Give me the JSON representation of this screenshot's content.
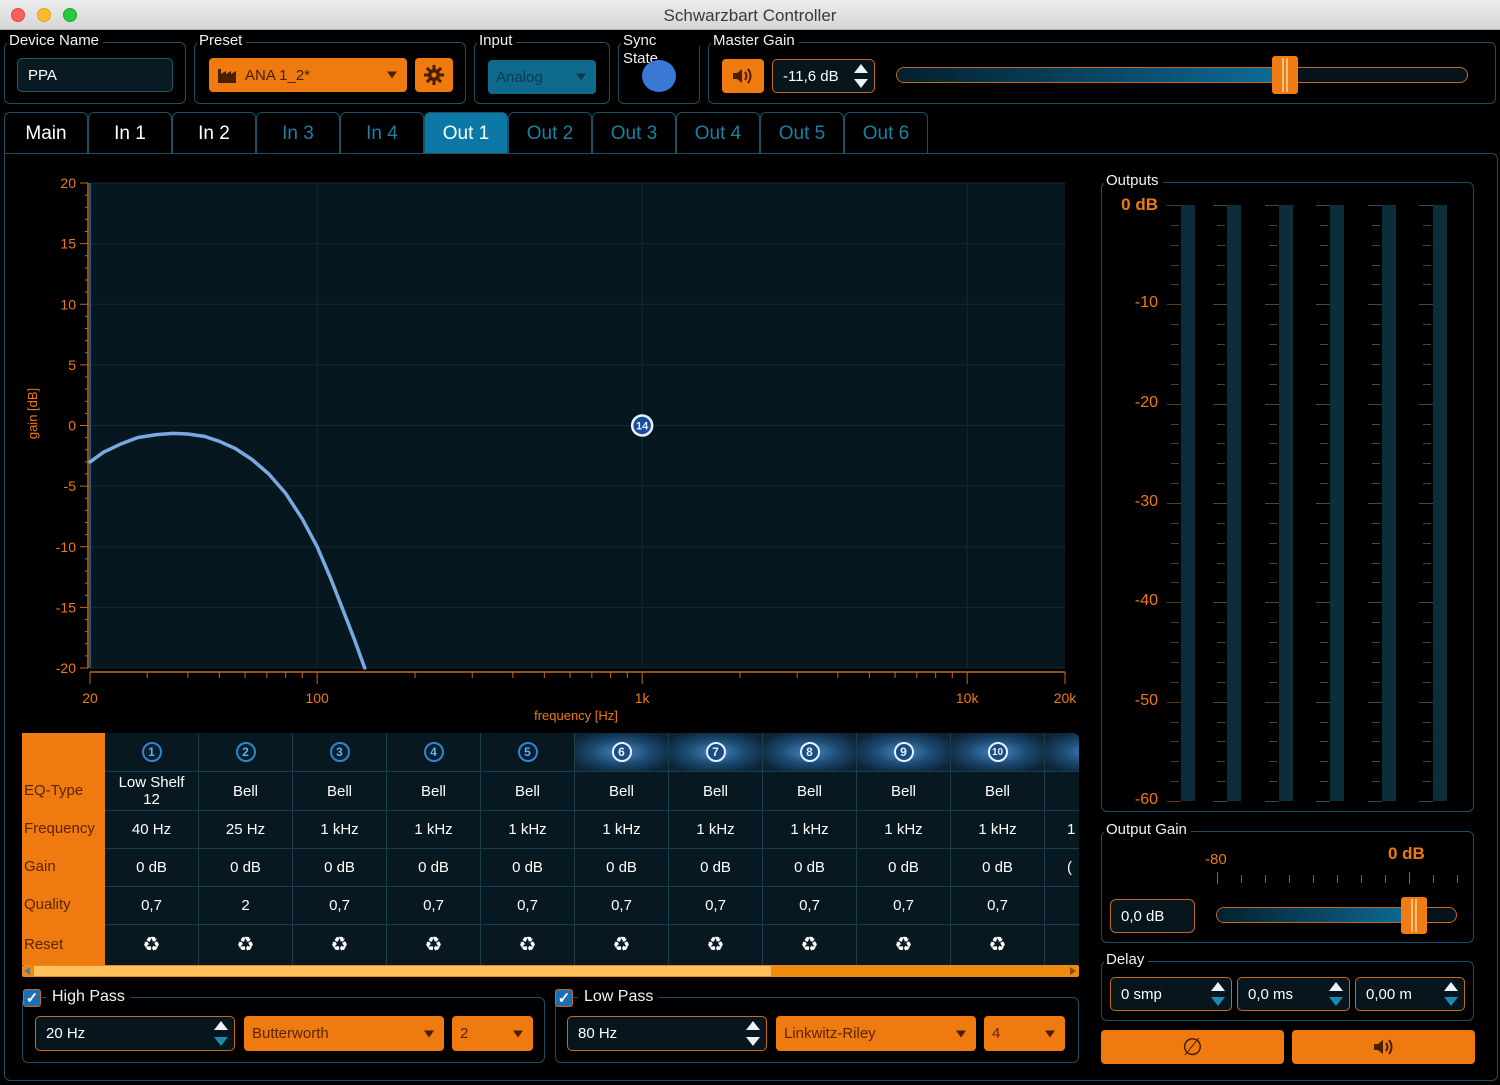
{
  "window": {
    "title": "Schwarzbart Controller"
  },
  "header": {
    "device_name": {
      "label": "Device Name",
      "value": "PPA"
    },
    "preset": {
      "label": "Preset",
      "value": "ANA 1_2*",
      "icon": "factory-icon",
      "settings_icon": "gear-icon"
    },
    "input": {
      "label": "Input",
      "value": "Analog"
    },
    "sync_state": {
      "label": "Sync State",
      "color": "#3a78d6"
    },
    "master_gain": {
      "label": "Master Gain",
      "value": "-11,6 dB",
      "mute_icon": "speaker-icon",
      "slider_fraction": 0.68
    }
  },
  "tabs": [
    {
      "label": "Main",
      "state": "normal"
    },
    {
      "label": "In 1",
      "state": "normal"
    },
    {
      "label": "In 2",
      "state": "normal"
    },
    {
      "label": "In 3",
      "state": "dim"
    },
    {
      "label": "In 4",
      "state": "dim"
    },
    {
      "label": "Out 1",
      "state": "active"
    },
    {
      "label": "Out 2",
      "state": "dim"
    },
    {
      "label": "Out 3",
      "state": "dim"
    },
    {
      "label": "Out 4",
      "state": "dim"
    },
    {
      "label": "Out 5",
      "state": "dim"
    },
    {
      "label": "Out 6",
      "state": "dim"
    }
  ],
  "chart_data": {
    "type": "line",
    "title": "",
    "xlabel": "frequency [Hz]",
    "ylabel": "gain [dB]",
    "xscale": "log",
    "xlim": [
      20,
      20000
    ],
    "ylim": [
      -20,
      20
    ],
    "xticks": [
      {
        "value": 20,
        "label": "20"
      },
      {
        "value": 100,
        "label": "100"
      },
      {
        "value": 1000,
        "label": "1k"
      },
      {
        "value": 10000,
        "label": "10k"
      },
      {
        "value": 20000,
        "label": "20k"
      }
    ],
    "yticks": [
      20,
      15,
      10,
      5,
      0,
      -5,
      -10,
      -15,
      -20
    ],
    "grid": true,
    "series": [
      {
        "name": "Out 1 response",
        "color": "#7aa8e0",
        "x": [
          20,
          22,
          25,
          28,
          32,
          36,
          40,
          45,
          50,
          56,
          63,
          71,
          80,
          90,
          100,
          110,
          120,
          130,
          140
        ],
        "y": [
          -3.0,
          -2.2,
          -1.5,
          -1.0,
          -0.75,
          -0.65,
          -0.7,
          -0.9,
          -1.3,
          -1.9,
          -2.8,
          -4.0,
          -5.6,
          -7.7,
          -10.0,
          -12.6,
          -15.2,
          -17.6,
          -20.0
        ]
      }
    ],
    "markers": [
      {
        "label": "14",
        "x": 1000,
        "y": 0
      }
    ]
  },
  "eq": {
    "row_labels": [
      "EQ-Type",
      "Frequency",
      "Gain",
      "Quality",
      "Reset"
    ],
    "bands": [
      {
        "num": "1",
        "type": "Low Shelf 12",
        "freq": "40 Hz",
        "gain": "0 dB",
        "q": "0,7",
        "selected": false
      },
      {
        "num": "2",
        "type": "Bell",
        "freq": "25 Hz",
        "gain": "0 dB",
        "q": "2",
        "selected": false
      },
      {
        "num": "3",
        "type": "Bell",
        "freq": "1 kHz",
        "gain": "0 dB",
        "q": "0,7",
        "selected": false
      },
      {
        "num": "4",
        "type": "Bell",
        "freq": "1 kHz",
        "gain": "0 dB",
        "q": "0,7",
        "selected": false
      },
      {
        "num": "5",
        "type": "Bell",
        "freq": "1 kHz",
        "gain": "0 dB",
        "q": "0,7",
        "selected": false
      },
      {
        "num": "6",
        "type": "Bell",
        "freq": "1 kHz",
        "gain": "0 dB",
        "q": "0,7",
        "selected": true
      },
      {
        "num": "7",
        "type": "Bell",
        "freq": "1 kHz",
        "gain": "0 dB",
        "q": "0,7",
        "selected": true
      },
      {
        "num": "8",
        "type": "Bell",
        "freq": "1 kHz",
        "gain": "0 dB",
        "q": "0,7",
        "selected": true
      },
      {
        "num": "9",
        "type": "Bell",
        "freq": "1 kHz",
        "gain": "0 dB",
        "q": "0,7",
        "selected": true
      },
      {
        "num": "10",
        "type": "Bell",
        "freq": "1 kHz",
        "gain": "0 dB",
        "q": "0,7",
        "selected": true
      },
      {
        "num": "",
        "type": "",
        "freq": "1",
        "gain": "(",
        "q": "",
        "selected": true
      }
    ],
    "reset_icon": "♻",
    "scroll_fraction": 0.7
  },
  "high_pass": {
    "label": "High Pass",
    "enabled": true,
    "freq": "20 Hz",
    "type": "Butterworth",
    "order": "2"
  },
  "low_pass": {
    "label": "Low Pass",
    "enabled": true,
    "freq": "80 Hz",
    "type": "Linkwitz-Riley",
    "order": "4"
  },
  "outputs": {
    "label": "Outputs",
    "scale_labels": [
      "0 dB",
      "-10",
      "-20",
      "-30",
      "-40",
      "-50",
      "-60"
    ],
    "channels": 6,
    "levels_db": [
      -60,
      -60,
      -60,
      -60,
      -60,
      -60
    ]
  },
  "output_gain": {
    "label": "Output Gain",
    "value": "0,0 dB",
    "min_label": "-80",
    "max_label": "0 dB",
    "slider_fraction": 0.82
  },
  "delay": {
    "label": "Delay",
    "samples": "0 smp",
    "ms": "0,0 ms",
    "meters": "0,00 m"
  },
  "buttons": {
    "phase_symbol": "∅",
    "mute_symbol": "🔊"
  }
}
